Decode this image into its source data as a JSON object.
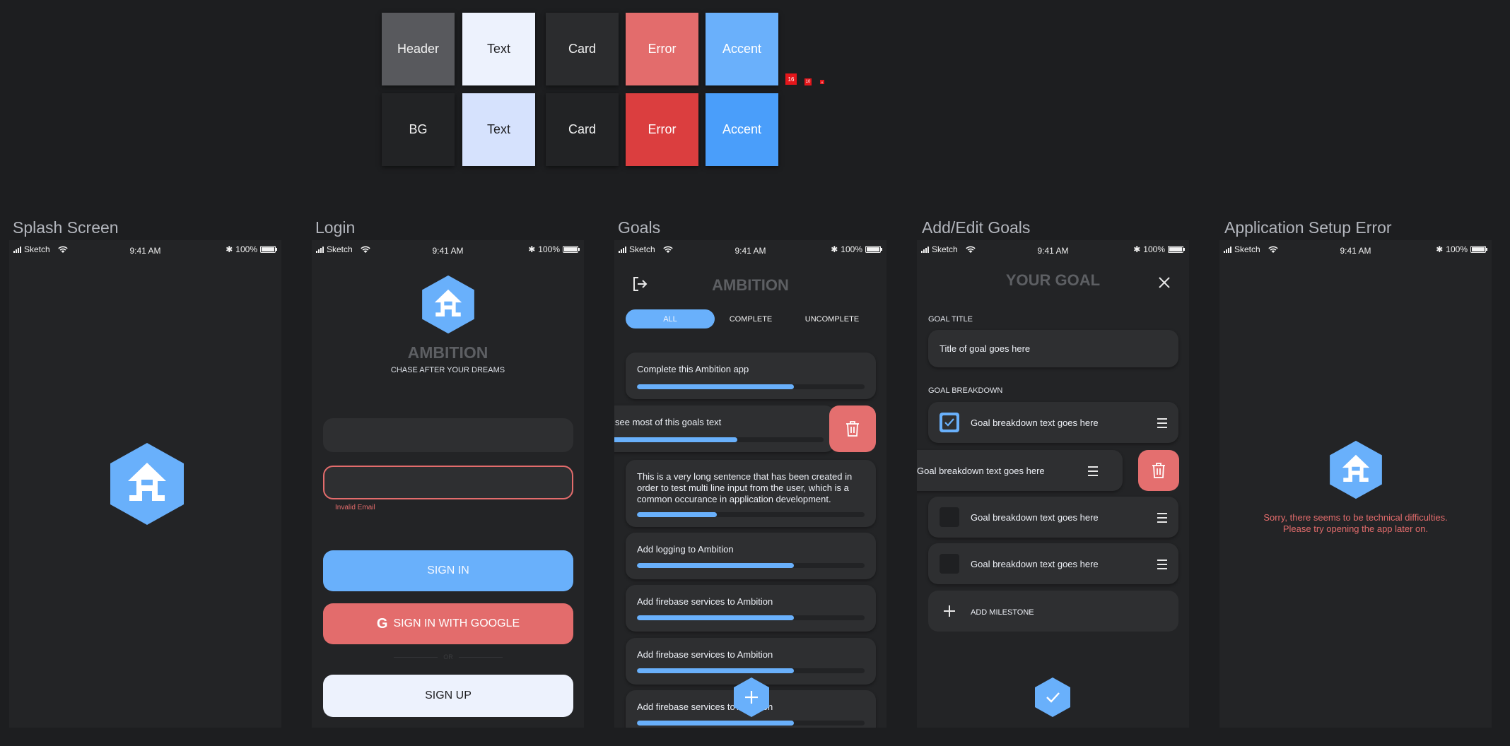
{
  "palette": {
    "swatches": [
      {
        "label": "Header",
        "color": "#58595d",
        "text_color": "#f2f2f2"
      },
      {
        "label": "Text",
        "color": "#edf2fd",
        "text_color": "#1f1f22"
      },
      {
        "label": "Card",
        "color": "#2b2c2e",
        "text_color": "#f2f2f2"
      },
      {
        "label": "Error",
        "color": "#e36c6c",
        "text_color": "#ffffff"
      },
      {
        "label": "Accent",
        "color": "#6ab0fb",
        "text_color": "#ffffff"
      },
      {
        "label": "BG",
        "color": "#222325",
        "text_color": "#f2f2f2"
      },
      {
        "label": "Text",
        "color": "#d6e2fd",
        "text_color": "#1f1f22"
      },
      {
        "label": "Card",
        "color": "#222325",
        "text_color": "#f2f2f2"
      },
      {
        "label": "Error",
        "color": "#db3e3f",
        "text_color": "#ffffff"
      },
      {
        "label": "Accent",
        "color": "#4a9efa",
        "text_color": "#ffffff"
      }
    ],
    "ticks": [
      "16",
      "10",
      "6"
    ]
  },
  "status_bar": {
    "carrier": "Sketch",
    "time": "9:41 AM",
    "battery": "100%"
  },
  "boards": {
    "splash": {
      "title": "Splash Screen"
    },
    "login": {
      "title": "Login",
      "app_name": "AMBITION",
      "tagline": "CHASE AFTER YOUR DREAMS",
      "error_text": "Invalid Email",
      "sign_in": "SIGN IN",
      "google": "SIGN IN WITH GOOGLE",
      "or": "OR",
      "sign_up": "SIGN UP"
    },
    "goals": {
      "title": "Goals",
      "header": "AMBITION",
      "tabs": [
        "ALL",
        "COMPLETE",
        "UNCOMPLETE"
      ],
      "items": [
        {
          "text": "Complete this Ambition app",
          "progress": 0.69
        },
        {
          "text": "see most of this goals text",
          "progress": 0.64
        },
        {
          "text": "This is a very long sentence that has been created in order to test multi line input from the user, which is a common occurance in application development.",
          "progress": 0.35
        },
        {
          "text": "Add logging to Ambition",
          "progress": 0.69
        },
        {
          "text": "Add firebase services to Ambition",
          "progress": 0.69
        },
        {
          "text": "Add firebase services to Ambition",
          "progress": 0.69
        },
        {
          "text": "Add firebase services to Ambition",
          "progress": 0.69
        }
      ]
    },
    "edit": {
      "title": "Add/Edit Goals",
      "header": "YOUR GOAL",
      "goal_title_label": "GOAL TITLE",
      "goal_title_value": "Title of goal goes here",
      "breakdown_label": "GOAL BREAKDOWN",
      "items": [
        {
          "text": "Goal breakdown text goes here",
          "checked": true
        },
        {
          "text": "Goal breakdown text goes here",
          "checked": false
        },
        {
          "text": "Goal breakdown text goes here",
          "checked": false
        },
        {
          "text": "Goal breakdown text goes here",
          "checked": false
        }
      ],
      "add_milestone": "ADD MILESTONE"
    },
    "setup_error": {
      "title": "Application Setup Error",
      "message_line1": "Sorry, there seems to be technical difficulties.",
      "message_line2": "Please try opening the app later on."
    }
  }
}
